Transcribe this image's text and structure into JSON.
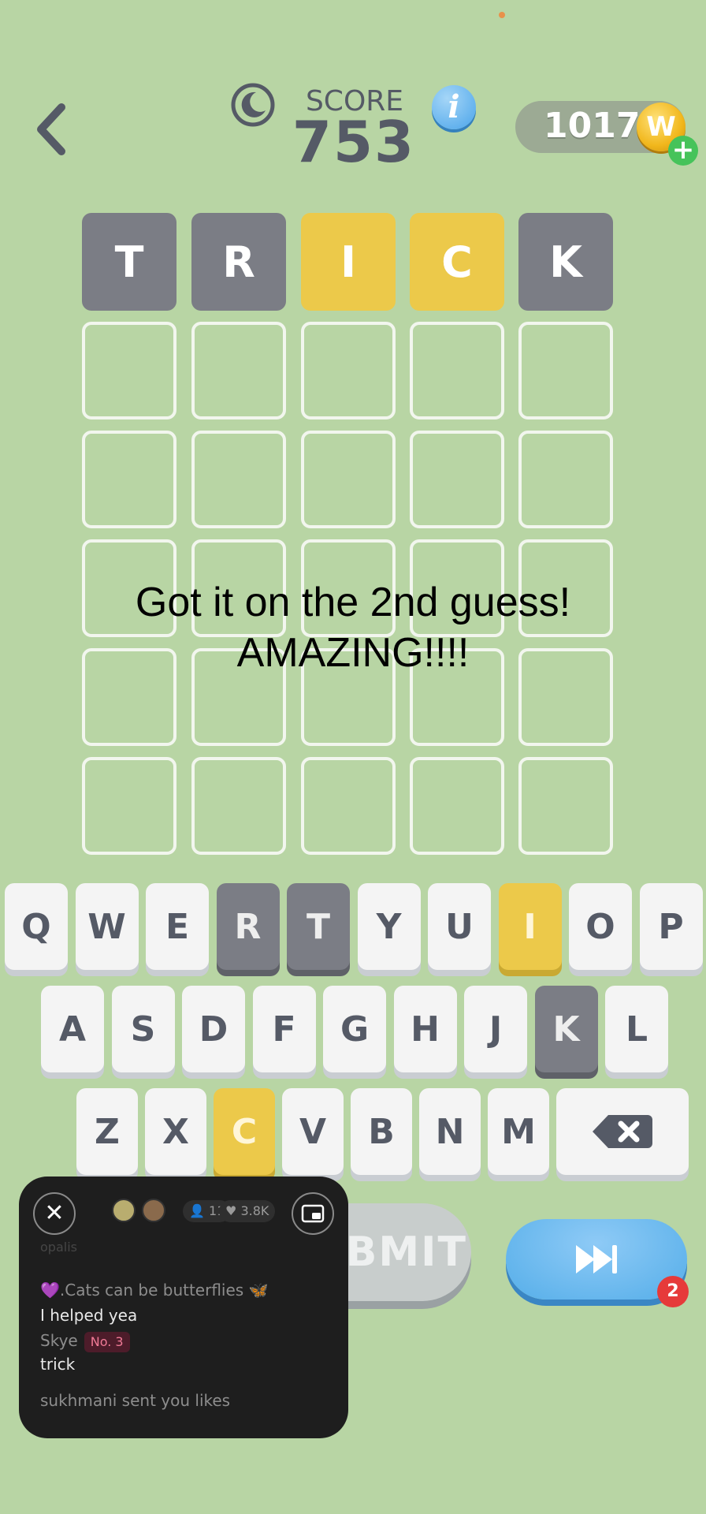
{
  "header": {
    "score_label": "SCORE",
    "score_value": "753",
    "info_label": "i",
    "coins": "1017",
    "coin_symbol": "W",
    "plus": "+"
  },
  "grid": {
    "rows": [
      [
        {
          "letter": "T",
          "state": "absent"
        },
        {
          "letter": "R",
          "state": "absent"
        },
        {
          "letter": "I",
          "state": "present"
        },
        {
          "letter": "C",
          "state": "present"
        },
        {
          "letter": "K",
          "state": "absent"
        }
      ],
      [
        {
          "letter": "",
          "state": "empty"
        },
        {
          "letter": "",
          "state": "empty"
        },
        {
          "letter": "",
          "state": "empty"
        },
        {
          "letter": "",
          "state": "empty"
        },
        {
          "letter": "",
          "state": "empty"
        }
      ],
      [
        {
          "letter": "",
          "state": "empty"
        },
        {
          "letter": "",
          "state": "empty"
        },
        {
          "letter": "",
          "state": "empty"
        },
        {
          "letter": "",
          "state": "empty"
        },
        {
          "letter": "",
          "state": "empty"
        }
      ],
      [
        {
          "letter": "",
          "state": "empty"
        },
        {
          "letter": "",
          "state": "empty"
        },
        {
          "letter": "",
          "state": "empty"
        },
        {
          "letter": "",
          "state": "empty"
        },
        {
          "letter": "",
          "state": "empty"
        }
      ],
      [
        {
          "letter": "",
          "state": "empty"
        },
        {
          "letter": "",
          "state": "empty"
        },
        {
          "letter": "",
          "state": "empty"
        },
        {
          "letter": "",
          "state": "empty"
        },
        {
          "letter": "",
          "state": "empty"
        }
      ],
      [
        {
          "letter": "",
          "state": "empty"
        },
        {
          "letter": "",
          "state": "empty"
        },
        {
          "letter": "",
          "state": "empty"
        },
        {
          "letter": "",
          "state": "empty"
        },
        {
          "letter": "",
          "state": "empty"
        }
      ]
    ]
  },
  "overlay": {
    "line1": "Got it on the 2nd guess!",
    "line2": "AMAZING!!!!"
  },
  "keyboard": {
    "rows": [
      [
        {
          "key": "Q",
          "state": "normal"
        },
        {
          "key": "W",
          "state": "normal"
        },
        {
          "key": "E",
          "state": "normal"
        },
        {
          "key": "R",
          "state": "absent"
        },
        {
          "key": "T",
          "state": "absent"
        },
        {
          "key": "Y",
          "state": "normal"
        },
        {
          "key": "U",
          "state": "normal"
        },
        {
          "key": "I",
          "state": "present"
        },
        {
          "key": "O",
          "state": "normal"
        },
        {
          "key": "P",
          "state": "normal"
        }
      ],
      [
        {
          "key": "A",
          "state": "normal"
        },
        {
          "key": "S",
          "state": "normal"
        },
        {
          "key": "D",
          "state": "normal"
        },
        {
          "key": "F",
          "state": "normal"
        },
        {
          "key": "G",
          "state": "normal"
        },
        {
          "key": "H",
          "state": "normal"
        },
        {
          "key": "J",
          "state": "normal"
        },
        {
          "key": "K",
          "state": "absent"
        },
        {
          "key": "L",
          "state": "normal"
        }
      ],
      [
        {
          "key": "Z",
          "state": "normal"
        },
        {
          "key": "X",
          "state": "normal"
        },
        {
          "key": "C",
          "state": "present"
        },
        {
          "key": "V",
          "state": "normal"
        },
        {
          "key": "B",
          "state": "normal"
        },
        {
          "key": "N",
          "state": "normal"
        },
        {
          "key": "M",
          "state": "normal"
        }
      ]
    ],
    "backspace_icon": "backspace-icon"
  },
  "buttons": {
    "submit_label": "SUBMIT",
    "skip_badge": "2"
  },
  "live_panel": {
    "viewers": "11",
    "likes": "3.8K",
    "chat": [
      {
        "text": "opalis",
        "style": "muted"
      },
      {
        "text": "💜.Cats can be butterflies 🦋",
        "style": "muted"
      },
      {
        "text": "I helped yea",
        "style": "white"
      },
      {
        "text": "Skye",
        "style": "muted",
        "badge": "No. 3"
      },
      {
        "text": "trick",
        "style": "white"
      }
    ],
    "notice_name": "sukhmani",
    "notice_text": " sent you likes"
  },
  "colors": {
    "background": "#b8d5a4",
    "absent": "#7b7d85",
    "present": "#ecc94a"
  }
}
